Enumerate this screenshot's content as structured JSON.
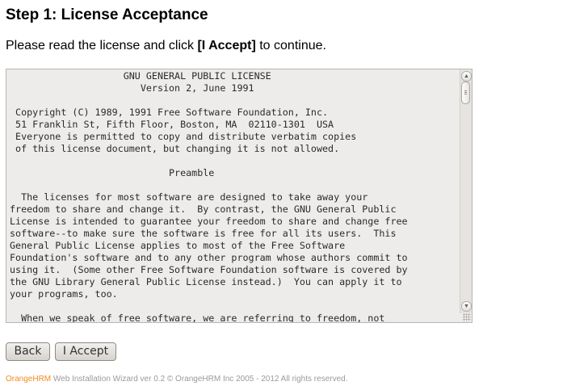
{
  "heading": "Step 1: License Acceptance",
  "instructions": {
    "prefix": "Please read the license and click ",
    "button_ref": "[I Accept]",
    "suffix": " to continue."
  },
  "license": {
    "text": "                    GNU GENERAL PUBLIC LICENSE\n                       Version 2, June 1991\n\n Copyright (C) 1989, 1991 Free Software Foundation, Inc.\n 51 Franklin St, Fifth Floor, Boston, MA  02110-1301  USA\n Everyone is permitted to copy and distribute verbatim copies\n of this license document, but changing it is not allowed.\n\n                            Preamble\n\n  The licenses for most software are designed to take away your\nfreedom to share and change it.  By contrast, the GNU General Public\nLicense is intended to guarantee your freedom to share and change free\nsoftware--to make sure the software is free for all its users.  This\nGeneral Public License applies to most of the Free Software\nFoundation's software and to any other program whose authors commit to\nusing it.  (Some other Free Software Foundation software is covered by\nthe GNU Library General Public License instead.)  You can apply it to\nyour programs, too.\n\n  When we speak of free software, we are referring to freedom, not"
  },
  "buttons": {
    "back_label": "Back",
    "accept_label": "I Accept"
  },
  "footer": {
    "brand": "OrangeHRM",
    "text": " Web Installation Wizard ver 0.2 © OrangeHRM Inc 2005 - 2012 All rights reserved."
  },
  "colors": {
    "brand": "#f28b21",
    "footer_text": "#9a9a9a",
    "textarea_background": "#edeceb"
  },
  "icons": {
    "scroll_up": "triangle-up-icon",
    "scroll_down": "triangle-down-icon",
    "resize": "resize-grip-icon"
  }
}
